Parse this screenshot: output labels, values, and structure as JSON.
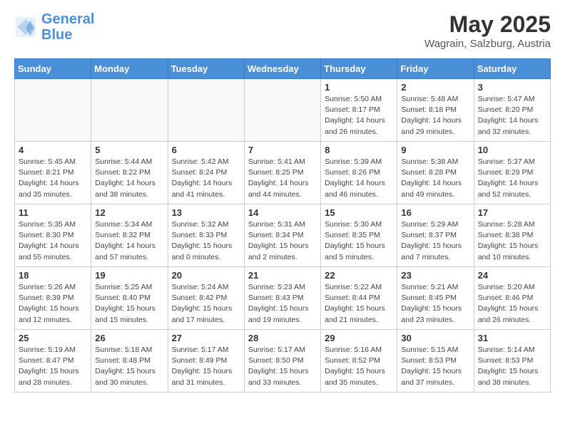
{
  "logo": {
    "line1": "General",
    "line2": "Blue"
  },
  "title": "May 2025",
  "location": "Wagrain, Salzburg, Austria",
  "weekdays": [
    "Sunday",
    "Monday",
    "Tuesday",
    "Wednesday",
    "Thursday",
    "Friday",
    "Saturday"
  ],
  "weeks": [
    [
      {
        "day": "",
        "info": ""
      },
      {
        "day": "",
        "info": ""
      },
      {
        "day": "",
        "info": ""
      },
      {
        "day": "",
        "info": ""
      },
      {
        "day": "1",
        "info": "Sunrise: 5:50 AM\nSunset: 8:17 PM\nDaylight: 14 hours\nand 26 minutes."
      },
      {
        "day": "2",
        "info": "Sunrise: 5:48 AM\nSunset: 8:18 PM\nDaylight: 14 hours\nand 29 minutes."
      },
      {
        "day": "3",
        "info": "Sunrise: 5:47 AM\nSunset: 8:20 PM\nDaylight: 14 hours\nand 32 minutes."
      }
    ],
    [
      {
        "day": "4",
        "info": "Sunrise: 5:45 AM\nSunset: 8:21 PM\nDaylight: 14 hours\nand 35 minutes."
      },
      {
        "day": "5",
        "info": "Sunrise: 5:44 AM\nSunset: 8:22 PM\nDaylight: 14 hours\nand 38 minutes."
      },
      {
        "day": "6",
        "info": "Sunrise: 5:42 AM\nSunset: 8:24 PM\nDaylight: 14 hours\nand 41 minutes."
      },
      {
        "day": "7",
        "info": "Sunrise: 5:41 AM\nSunset: 8:25 PM\nDaylight: 14 hours\nand 44 minutes."
      },
      {
        "day": "8",
        "info": "Sunrise: 5:39 AM\nSunset: 8:26 PM\nDaylight: 14 hours\nand 46 minutes."
      },
      {
        "day": "9",
        "info": "Sunrise: 5:38 AM\nSunset: 8:28 PM\nDaylight: 14 hours\nand 49 minutes."
      },
      {
        "day": "10",
        "info": "Sunrise: 5:37 AM\nSunset: 8:29 PM\nDaylight: 14 hours\nand 52 minutes."
      }
    ],
    [
      {
        "day": "11",
        "info": "Sunrise: 5:35 AM\nSunset: 8:30 PM\nDaylight: 14 hours\nand 55 minutes."
      },
      {
        "day": "12",
        "info": "Sunrise: 5:34 AM\nSunset: 8:32 PM\nDaylight: 14 hours\nand 57 minutes."
      },
      {
        "day": "13",
        "info": "Sunrise: 5:32 AM\nSunset: 8:33 PM\nDaylight: 15 hours\nand 0 minutes."
      },
      {
        "day": "14",
        "info": "Sunrise: 5:31 AM\nSunset: 8:34 PM\nDaylight: 15 hours\nand 2 minutes."
      },
      {
        "day": "15",
        "info": "Sunrise: 5:30 AM\nSunset: 8:35 PM\nDaylight: 15 hours\nand 5 minutes."
      },
      {
        "day": "16",
        "info": "Sunrise: 5:29 AM\nSunset: 8:37 PM\nDaylight: 15 hours\nand 7 minutes."
      },
      {
        "day": "17",
        "info": "Sunrise: 5:28 AM\nSunset: 8:38 PM\nDaylight: 15 hours\nand 10 minutes."
      }
    ],
    [
      {
        "day": "18",
        "info": "Sunrise: 5:26 AM\nSunset: 8:39 PM\nDaylight: 15 hours\nand 12 minutes."
      },
      {
        "day": "19",
        "info": "Sunrise: 5:25 AM\nSunset: 8:40 PM\nDaylight: 15 hours\nand 15 minutes."
      },
      {
        "day": "20",
        "info": "Sunrise: 5:24 AM\nSunset: 8:42 PM\nDaylight: 15 hours\nand 17 minutes."
      },
      {
        "day": "21",
        "info": "Sunrise: 5:23 AM\nSunset: 8:43 PM\nDaylight: 15 hours\nand 19 minutes."
      },
      {
        "day": "22",
        "info": "Sunrise: 5:22 AM\nSunset: 8:44 PM\nDaylight: 15 hours\nand 21 minutes."
      },
      {
        "day": "23",
        "info": "Sunrise: 5:21 AM\nSunset: 8:45 PM\nDaylight: 15 hours\nand 23 minutes."
      },
      {
        "day": "24",
        "info": "Sunrise: 5:20 AM\nSunset: 8:46 PM\nDaylight: 15 hours\nand 26 minutes."
      }
    ],
    [
      {
        "day": "25",
        "info": "Sunrise: 5:19 AM\nSunset: 8:47 PM\nDaylight: 15 hours\nand 28 minutes."
      },
      {
        "day": "26",
        "info": "Sunrise: 5:18 AM\nSunset: 8:48 PM\nDaylight: 15 hours\nand 30 minutes."
      },
      {
        "day": "27",
        "info": "Sunrise: 5:17 AM\nSunset: 8:49 PM\nDaylight: 15 hours\nand 31 minutes."
      },
      {
        "day": "28",
        "info": "Sunrise: 5:17 AM\nSunset: 8:50 PM\nDaylight: 15 hours\nand 33 minutes."
      },
      {
        "day": "29",
        "info": "Sunrise: 5:16 AM\nSunset: 8:52 PM\nDaylight: 15 hours\nand 35 minutes."
      },
      {
        "day": "30",
        "info": "Sunrise: 5:15 AM\nSunset: 8:53 PM\nDaylight: 15 hours\nand 37 minutes."
      },
      {
        "day": "31",
        "info": "Sunrise: 5:14 AM\nSunset: 8:53 PM\nDaylight: 15 hours\nand 38 minutes."
      }
    ]
  ]
}
